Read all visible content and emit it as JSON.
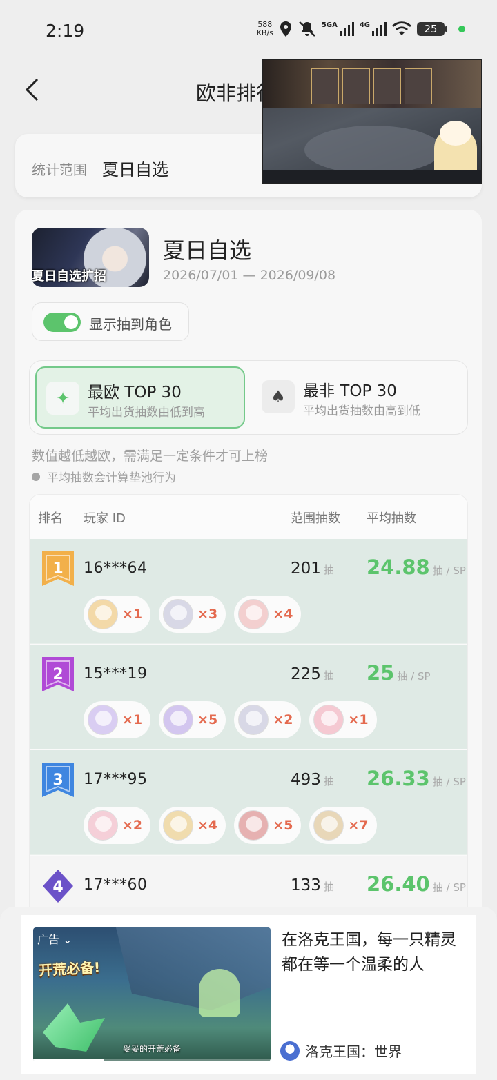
{
  "status": {
    "time": "2:19",
    "speed_value": "588",
    "speed_unit": "KB/s",
    "net1": "5GA",
    "net2": "4G",
    "battery": "25"
  },
  "header": {
    "title": "欧非排行"
  },
  "range": {
    "label": "统计范围",
    "value": "夏日自选"
  },
  "pool": {
    "banner_text": "夏日自选扩招",
    "name": "夏日自选",
    "dates": "2026/07/01 — 2026/09/08",
    "toggle_label": "显示抽到角色",
    "toggle_on": true
  },
  "modes": [
    {
      "icon": "✦",
      "title": "最欧 TOP 30",
      "sub": "平均出货抽数由低到高",
      "active": true
    },
    {
      "icon": "♠",
      "title": "最非 TOP 30",
      "sub": "平均出货抽数由高到低",
      "active": false
    }
  ],
  "notes": {
    "line1": "数值越低越欧，需满足一定条件才可上榜",
    "line2": "平均抽数会计算垫池行为"
  },
  "table": {
    "headers": [
      "排名",
      "玩家 ID",
      "范围抽数",
      "平均抽数"
    ],
    "pull_unit": "抽",
    "avg_unit": "抽 / SP",
    "rows": [
      {
        "rank": "1",
        "badge_color": "#f2b04a",
        "player": "16***64",
        "pulls": "201",
        "avg": "24.88",
        "chars": [
          {
            "count": "×1",
            "color": "#f3d9a8"
          },
          {
            "count": "×3",
            "color": "#d8d8e6"
          },
          {
            "count": "×4",
            "color": "#f3cfcf"
          }
        ]
      },
      {
        "rank": "2",
        "badge_color": "#b04ad6",
        "player": "15***19",
        "pulls": "225",
        "avg": "25",
        "chars": [
          {
            "count": "×1",
            "color": "#d9cdf2"
          },
          {
            "count": "×5",
            "color": "#d3c6ef"
          },
          {
            "count": "×2",
            "color": "#d8d8e6"
          },
          {
            "count": "×1",
            "color": "#f5c9d2"
          }
        ]
      },
      {
        "rank": "3",
        "badge_color": "#3f86e0",
        "player": "17***95",
        "pulls": "493",
        "avg": "26.33",
        "chars": [
          {
            "count": "×2",
            "color": "#f5cfd8"
          },
          {
            "count": "×4",
            "color": "#f0dcae"
          },
          {
            "count": "×5",
            "color": "#e6b1b1"
          },
          {
            "count": "×7",
            "color": "#e8d7b8"
          }
        ]
      },
      {
        "rank": "4",
        "badge_color": "#6b52c8",
        "player": "17***60",
        "pulls": "133",
        "avg": "26.40",
        "chars": []
      }
    ]
  },
  "ad": {
    "tag": "广告",
    "headline": "开荒必备!",
    "caption": "妥妥的开荒必备",
    "progress": 0.3,
    "title": "在洛克王国，每一只精灵都在等一个温柔的人",
    "brand": "洛克王国：世界"
  }
}
